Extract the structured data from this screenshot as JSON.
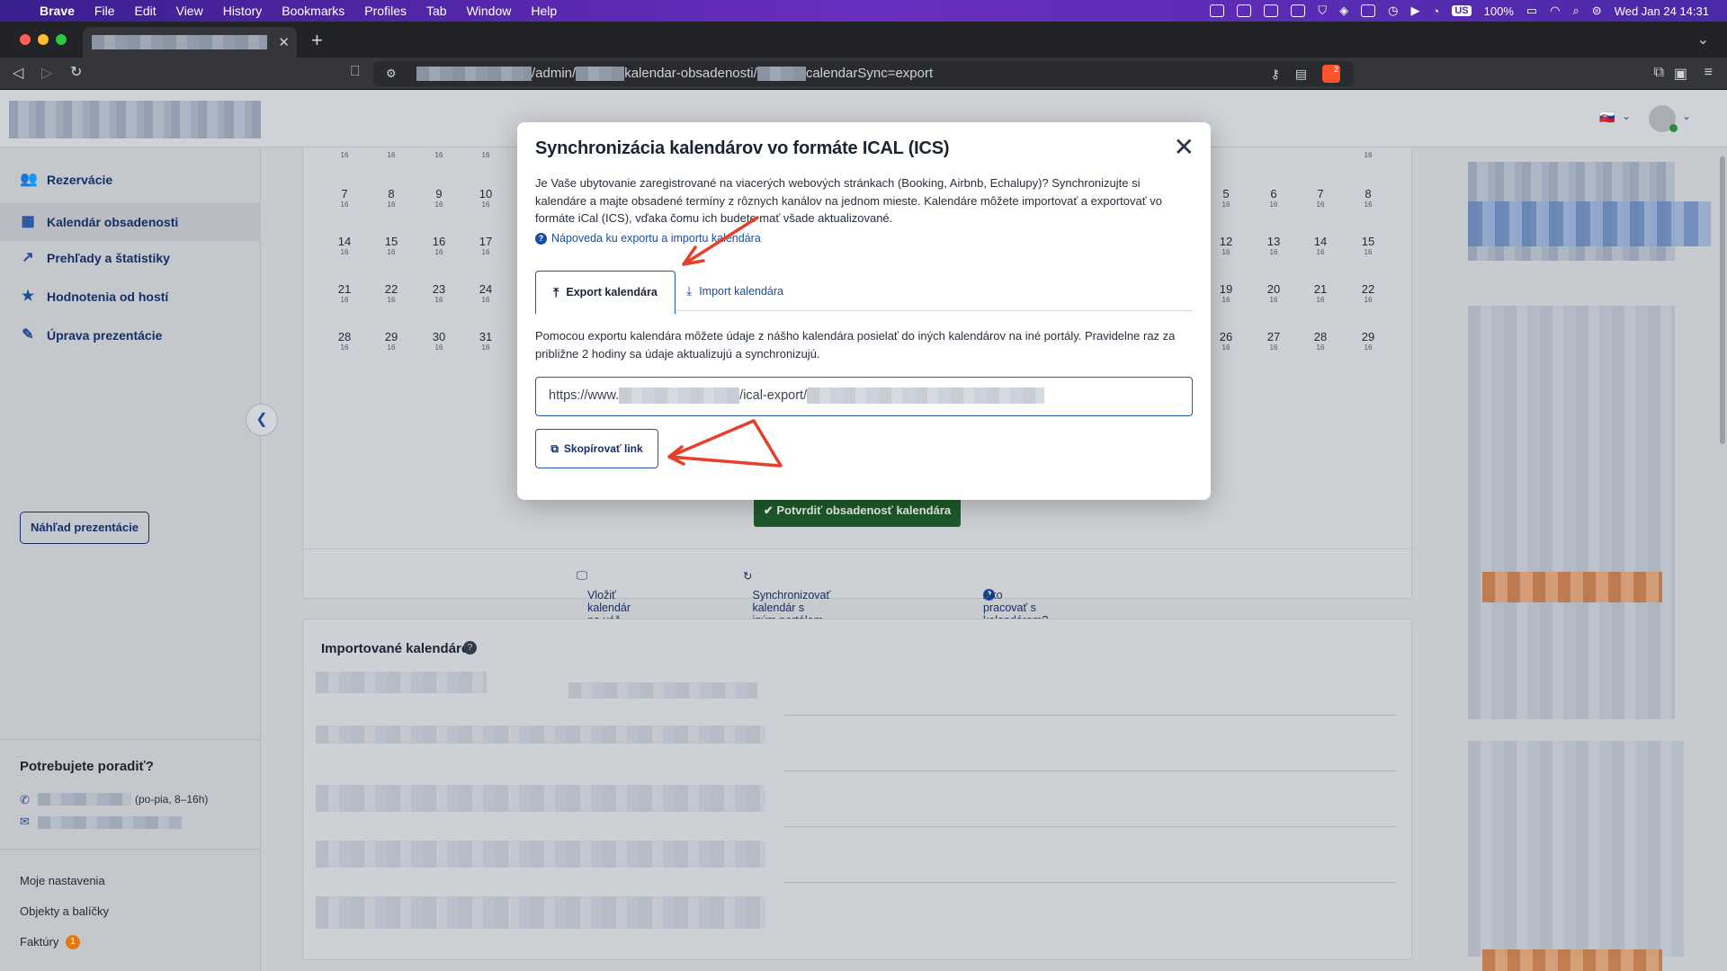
{
  "menubar": {
    "apple": "",
    "items": [
      "Brave",
      "File",
      "Edit",
      "View",
      "History",
      "Bookmarks",
      "Profiles",
      "Tab",
      "Window",
      "Help"
    ],
    "status": {
      "kb": "US",
      "battery": "100%",
      "datetime": "Wed Jan 24  14:31"
    }
  },
  "browser": {
    "url_parts": [
      "/admin/",
      "kalendar-obsadenosti/",
      "calendarSync=export"
    ],
    "shields_badge": "2"
  },
  "sidebar": {
    "items": [
      {
        "label": "Rezervácie",
        "icon": "users-icon"
      },
      {
        "label": "Kalendár obsadenosti",
        "icon": "calendar-icon"
      },
      {
        "label": "Prehľady a štatistiky",
        "icon": "chart-icon"
      },
      {
        "label": "Hodnotenia od hostí",
        "icon": "star-icon"
      },
      {
        "label": "Úprava prezentácie",
        "icon": "edit-icon"
      }
    ],
    "preview_button": "Náhľad prezentácie",
    "help_title": "Potrebujete poradiť?",
    "help_hours": "(po-pia, 8–16h)",
    "footer_links": [
      "Moje nastavenia",
      "Objekty a balíčky",
      "Faktúry"
    ],
    "invoices_badge": "1"
  },
  "calendar": {
    "left_rows": [
      [
        "7",
        "8",
        "9",
        "10"
      ],
      [
        "14",
        "15",
        "16",
        "17"
      ],
      [
        "21",
        "22",
        "23",
        "24"
      ],
      [
        "28",
        "29",
        "30",
        "31"
      ]
    ],
    "right_rows": [
      [
        "5",
        "6",
        "7",
        "8"
      ],
      [
        "12",
        "13",
        "14",
        "15"
      ],
      [
        "19",
        "20",
        "21",
        "22"
      ],
      [
        "26",
        "27",
        "28",
        "29"
      ]
    ],
    "sub": "16",
    "confirm_button": "Potvrdiť obsadenosť kalendára",
    "links": [
      "Vložiť kalendár na váš web",
      "Synchronizovať kalendár s iným portálom",
      "Ako pracovať s kalendárom?"
    ]
  },
  "imported": {
    "title": "Importované kalendáre"
  },
  "modal": {
    "title": "Synchronizácia kalendárov vo formáte ICAL (ICS)",
    "description": "Je Vaše ubytovanie zaregistrované na viacerých webových stránkach (Booking, Airbnb, Echalupy)? Synchronizujte si kalendáre a majte obsadené termíny z rôznych kanálov na jednom mieste. Kalendáre môžete importovať a exportovať vo formáte iCal (ICS), vďaka čomu ich budete mať všade aktualizované.",
    "help_link": "Nápoveda ku exportu a importu kalendára",
    "tabs": {
      "export": "Export kalendára",
      "import": "Import kalendára"
    },
    "export_description": "Pomocou exportu kalendára môžete údaje z nášho kalendára posielať do iných kalendárov na iné portály. Pravidelne raz za približne 2 hodiny sa údaje aktualizujú a synchronizujú.",
    "url_prefix": "https://www.",
    "url_middle": "/ical-export/",
    "copy_button": "Skopírovať link"
  }
}
